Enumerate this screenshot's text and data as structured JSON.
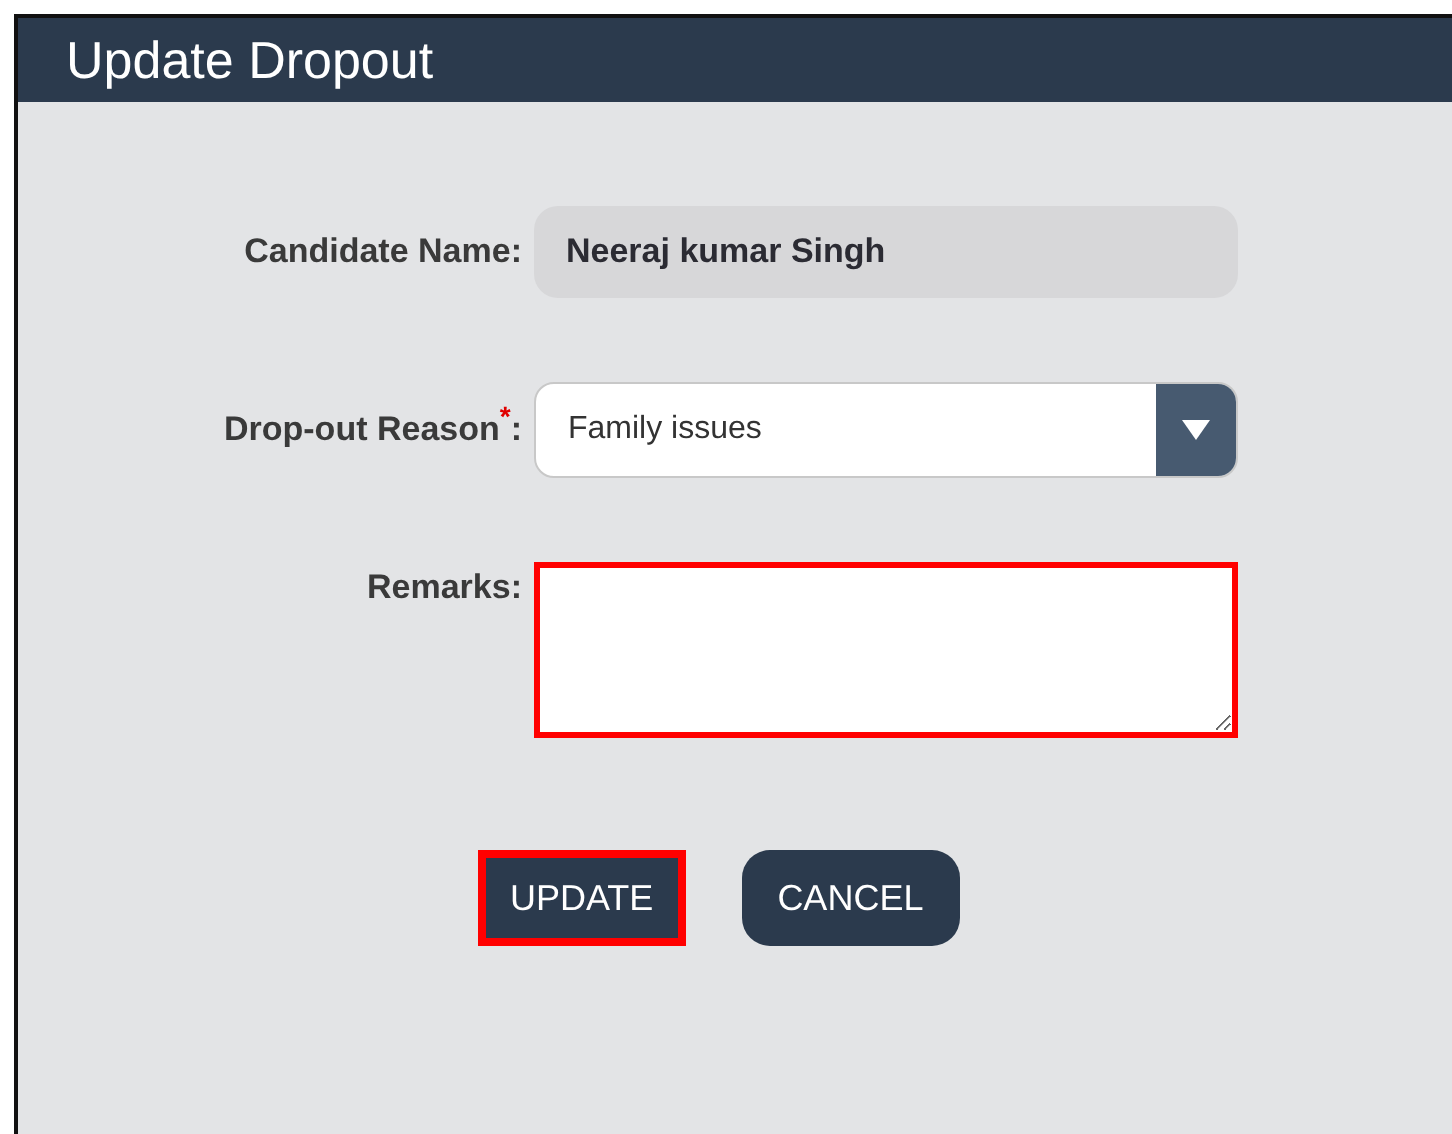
{
  "dialog": {
    "title": "Update Dropout"
  },
  "fields": [
    {
      "kind": "readonly",
      "label": "Candidate Name:",
      "value": "Neeraj kumar Singh"
    },
    {
      "kind": "select",
      "label": "Drop-out Reason$^{*}$:",
      "value": "Family issues"
    },
    {
      "kind": "textarea",
      "label": "Remarks:",
      "highlighted": true
    }
  ],
  "buttons": [
    {
      "label": "UPDATE",
      "highlighted": true
    },
    {
      "label": "CANCEL",
      "highlighted": false
    }
  ]
}
